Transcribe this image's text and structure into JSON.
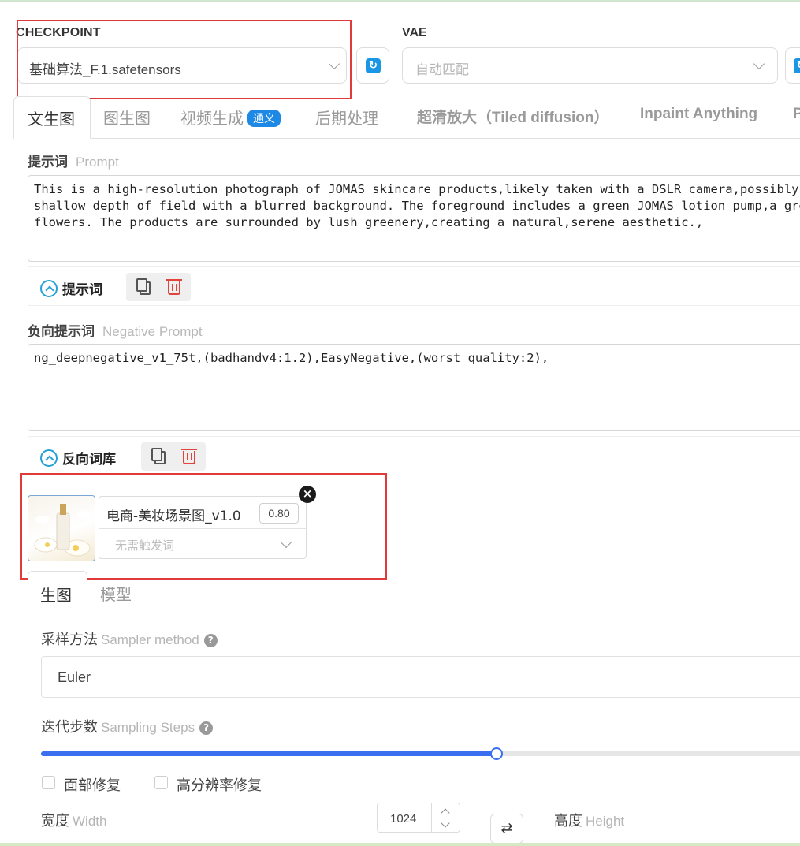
{
  "checkpoint": {
    "label": "CHECKPOINT",
    "value": "基础算法_F.1.safetensors"
  },
  "vae": {
    "label": "VAE",
    "placeholder": "自动匹配"
  },
  "tabs": [
    {
      "label": "文生图",
      "active": true
    },
    {
      "label": "图生图"
    },
    {
      "label": "视频生成",
      "badge": "通义"
    },
    {
      "label": "后期处理"
    },
    {
      "label": "超清放大（Tiled diffusion）"
    },
    {
      "label": "Inpaint Anything"
    },
    {
      "label": "P"
    }
  ],
  "prompt": {
    "title": "提示词",
    "subtitle": "Prompt",
    "lines": [
      "This is a high-resolution photograph of JOMAS skincare products,likely taken with a DSLR camera,possibly a",
      "shallow depth of field with a blurred background. The foreground includes a green JOMAS lotion pump,a gre",
      "flowers. The products are surrounded by lush greenery,creating a natural,serene aesthetic.,"
    ],
    "toolbar_label": "提示词"
  },
  "negative_prompt": {
    "title": "负向提示词",
    "subtitle": "Negative Prompt",
    "text": "ng_deepnegative_v1_75t,(badhandv4:1.2),EasyNegative,(worst quality:2),",
    "toolbar_label": "反向词库"
  },
  "lora": {
    "name": "电商-美妆场景图_v1.0",
    "weight": "0.80",
    "trigger_placeholder": "无需触发词",
    "close_icon": "×"
  },
  "subtabs": [
    {
      "label": "生图",
      "active": true
    },
    {
      "label": "模型"
    }
  ],
  "sampler": {
    "label": "采样方法",
    "label_en": "Sampler method",
    "value": "Euler"
  },
  "steps": {
    "label": "迭代步数",
    "label_en": "Sampling Steps",
    "fraction": 0.59
  },
  "checkboxes": [
    {
      "label": "面部修复",
      "checked": false
    },
    {
      "label": "高分辨率修复",
      "checked": false
    }
  ],
  "width": {
    "label": "宽度",
    "label_en": "Width",
    "value": "1024"
  },
  "height": {
    "label": "高度",
    "label_en": "Height"
  },
  "help_icon": "?",
  "swap_icon": "⇄",
  "colors": {
    "accent": "#1e88e5",
    "highlight_box": "#e03a3a",
    "slider": "#3b6ff0",
    "delete": "#e0443a"
  }
}
